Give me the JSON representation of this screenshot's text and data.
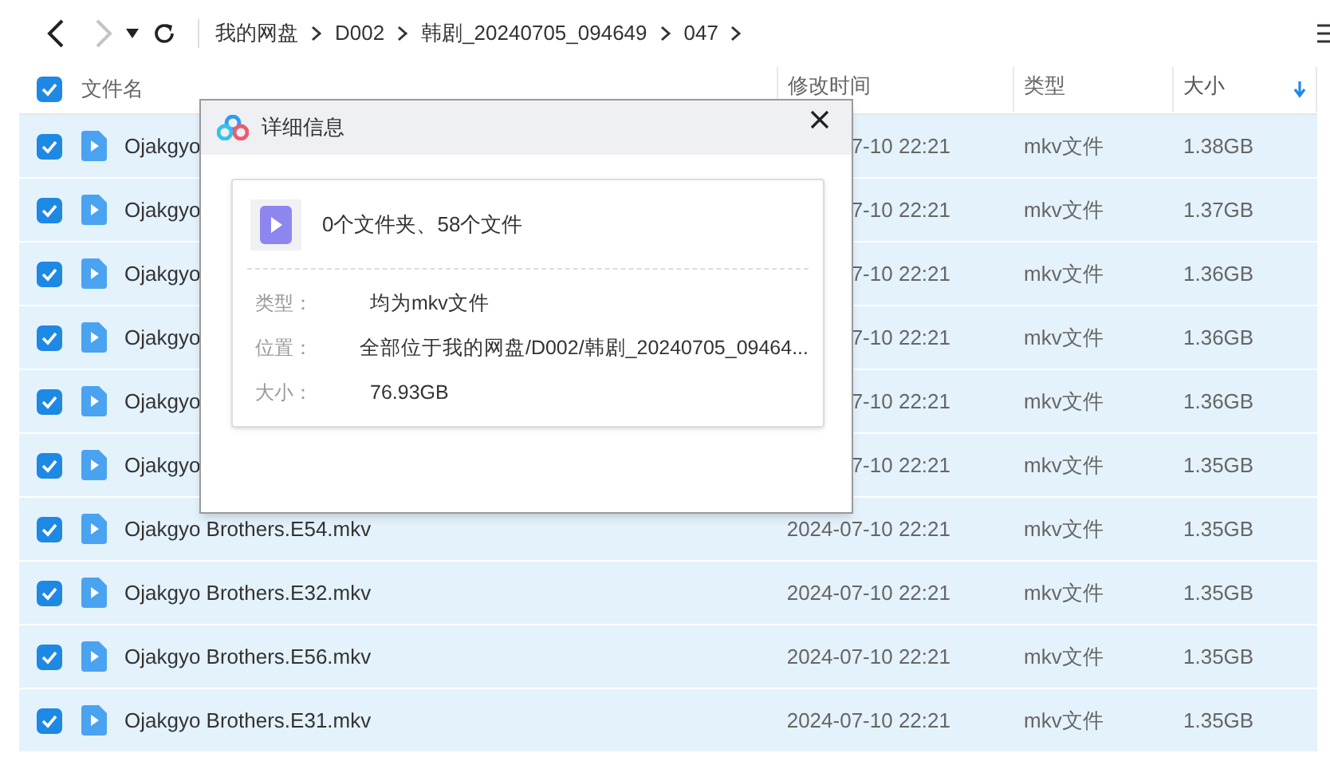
{
  "nav_buttons": [
    {
      "kind": "back",
      "disabled": false
    },
    {
      "kind": "forward",
      "disabled": true
    },
    {
      "kind": "dropdown"
    },
    {
      "kind": "refresh"
    }
  ],
  "breadcrumb": [
    "我的网盘",
    "D002",
    "韩剧_20240705_094649",
    "047"
  ],
  "table": {
    "select_all": {
      "checked": true
    },
    "columns": [
      {
        "label": "文件名",
        "sorted": false
      },
      {
        "label": "修改时间",
        "sorted": false
      },
      {
        "label": "类型",
        "sorted": false
      },
      {
        "label": "大小",
        "sorted": true
      }
    ],
    "rows": [
      {
        "name": "Ojakgyo",
        "date": "7-10 22:21",
        "type": "mkv文件",
        "size": "1.38GB",
        "checked": true,
        "selected": true
      },
      {
        "name": "Ojakgyo",
        "date": "7-10 22:21",
        "type": "mkv文件",
        "size": "1.37GB",
        "checked": true,
        "selected": true
      },
      {
        "name": "Ojakgyo",
        "date": "7-10 22:21",
        "type": "mkv文件",
        "size": "1.36GB",
        "checked": true,
        "selected": true
      },
      {
        "name": "Ojakgyo",
        "date": "7-10 22:21",
        "type": "mkv文件",
        "size": "1.36GB",
        "checked": true,
        "selected": true
      },
      {
        "name": "Ojakgyo",
        "date": "7-10 22:21",
        "type": "mkv文件",
        "size": "1.36GB",
        "checked": true,
        "selected": true
      },
      {
        "name": "Ojakgyo",
        "date": "7-10 22:21",
        "type": "mkv文件",
        "size": "1.35GB",
        "checked": true,
        "selected": true
      },
      {
        "name": "Ojakgyo Brothers.E54.mkv",
        "date": "2024-07-10 22:21",
        "type": "mkv文件",
        "size": "1.35GB",
        "checked": true,
        "selected": true
      },
      {
        "name": "Ojakgyo Brothers.E32.mkv",
        "date": "2024-07-10 22:21",
        "type": "mkv文件",
        "size": "1.35GB",
        "checked": true,
        "selected": true
      },
      {
        "name": "Ojakgyo Brothers.E56.mkv",
        "date": "2024-07-10 22:21",
        "type": "mkv文件",
        "size": "1.35GB",
        "checked": true,
        "selected": true
      },
      {
        "name": "Ojakgyo Brothers.E31.mkv",
        "date": "2024-07-10 22:21",
        "type": "mkv文件",
        "size": "1.35GB",
        "checked": true,
        "selected": true
      }
    ]
  },
  "dialog": {
    "title": "详细信息",
    "summary": "0个文件夹、58个文件",
    "fields": [
      {
        "label": "类型：",
        "value": "均为mkv文件"
      },
      {
        "label": "位置：",
        "value": "全部位于我的网盘/D002/韩剧_20240705_09464..."
      },
      {
        "label": "大小：",
        "value": "76.93GB"
      }
    ]
  }
}
